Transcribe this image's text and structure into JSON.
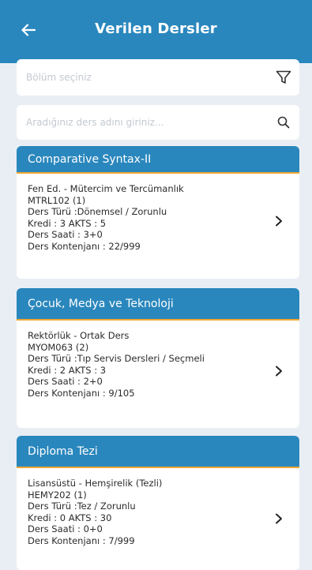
{
  "header": {
    "title": "Verilen Dersler"
  },
  "filters": {
    "department_placeholder": "Bölüm seçiniz",
    "search_placeholder": "Aradığınız ders adını giriniz..."
  },
  "courses": [
    {
      "title": "Comparative Syntax-II",
      "unit": "Fen Ed. - Mütercim ve Tercümanlık",
      "code": "MTRL102 (1)",
      "type": "Ders Türü :Dönemsel / Zorunlu",
      "credits": "Kredi : 3   AKTS : 5",
      "hours": "Ders Saati : 3+0",
      "quota": "Ders Kontenjanı : 22/999"
    },
    {
      "title": "Çocuk, Medya ve Teknoloji",
      "unit": "Rektörlük - Ortak Ders",
      "code": "MYOM063 (2)",
      "type": "Ders Türü :Tıp Servis Dersleri / Seçmeli",
      "credits": "Kredi : 2   AKTS : 3",
      "hours": "Ders Saati : 2+0",
      "quota": "Ders Kontenjanı : 9/105"
    },
    {
      "title": "Diploma Tezi",
      "unit": "Lisansüstü - Hemşirelik (Tezli)",
      "code": "HEMY202 (1)",
      "type": "Ders Türü :Tez / Zorunlu",
      "credits": "Kredi : 0   AKTS : 30",
      "hours": "Ders Saati : 0+0",
      "quota": "Ders Kontenjanı : 7/999"
    }
  ],
  "icons": {
    "back": "arrow-left-icon",
    "filter": "filter-icon",
    "search": "search-icon",
    "chevron": "chevron-right-icon"
  },
  "colors": {
    "primary": "#2a87bd",
    "accent": "#f0a732",
    "background": "#e9eef4"
  }
}
